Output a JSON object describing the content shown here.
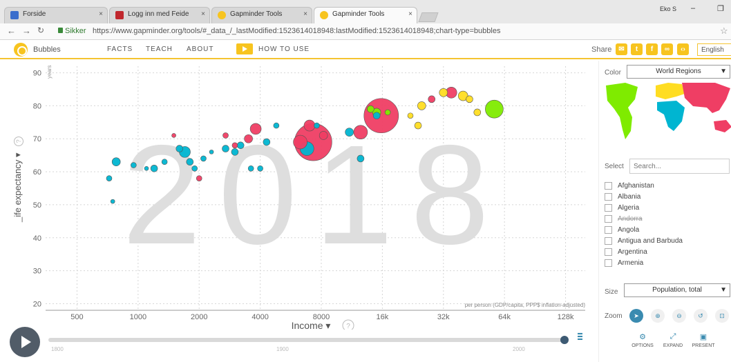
{
  "browser": {
    "tabs": [
      {
        "label": "Forside",
        "color": "#3b6ecc"
      },
      {
        "label": "Logg inn med Feide",
        "color": "#c0272d"
      },
      {
        "label": "Gapminder Tools",
        "color": "#f7c41f"
      },
      {
        "label": "Gapminder Tools",
        "color": "#f7c41f"
      }
    ],
    "close_glyph": "×",
    "user": "Eko S",
    "secure_label": "Sikker",
    "url": "https://www.gapminder.org/tools/#_data_/_lastModified:1523614018948:lastModified:1523614018948;chart-type=bubbles"
  },
  "app": {
    "title": "Bubbles",
    "menu": [
      "FACTS",
      "TEACH",
      "ABOUT"
    ],
    "how_to_use": "HOW TO USE",
    "share_label": "Share",
    "language": "English"
  },
  "chart": {
    "year_watermark": "2018",
    "y_unit": "years",
    "y_axis_label": "_ife expectancy ▾",
    "x_axis_label": "Income ▾",
    "x_note": "per person (GDP/capita, PPP$ inflation-adjusted)",
    "accent": "#f4c430"
  },
  "chart_data": {
    "type": "scatter",
    "title": "",
    "xlabel": "Income",
    "ylabel": "_ife expectancy",
    "x_scale": "log",
    "x_ticks": [
      500,
      1000,
      2000,
      4000,
      8000,
      16000,
      32000,
      64000,
      128000
    ],
    "x_tick_labels": [
      "500",
      "1000",
      "2000",
      "4000",
      "8000",
      "16k",
      "32k",
      "64k",
      "128k"
    ],
    "y_ticks": [
      20,
      30,
      40,
      50,
      60,
      70,
      80,
      90
    ],
    "xlim": [
      350,
      160000
    ],
    "ylim": [
      18,
      92
    ],
    "color_legend": {
      "africa": "#00b5d1",
      "asia": "#ef3e64",
      "europe": "#ffdd22",
      "americas": "#7feb00"
    },
    "points": [
      {
        "x": 720,
        "y": 58,
        "r": 4,
        "c": "africa"
      },
      {
        "x": 750,
        "y": 51,
        "r": 3,
        "c": "africa"
      },
      {
        "x": 780,
        "y": 63,
        "r": 6,
        "c": "africa"
      },
      {
        "x": 950,
        "y": 62,
        "r": 4,
        "c": "africa"
      },
      {
        "x": 1100,
        "y": 61,
        "r": 3,
        "c": "africa"
      },
      {
        "x": 1200,
        "y": 61,
        "r": 5,
        "c": "africa"
      },
      {
        "x": 1350,
        "y": 63,
        "r": 4,
        "c": "africa"
      },
      {
        "x": 1600,
        "y": 67,
        "r": 5,
        "c": "africa"
      },
      {
        "x": 1700,
        "y": 66,
        "r": 8,
        "c": "africa"
      },
      {
        "x": 1800,
        "y": 63,
        "r": 5,
        "c": "africa"
      },
      {
        "x": 1900,
        "y": 61,
        "r": 4,
        "c": "africa"
      },
      {
        "x": 2100,
        "y": 64,
        "r": 4,
        "c": "africa"
      },
      {
        "x": 2300,
        "y": 66,
        "r": 3,
        "c": "africa"
      },
      {
        "x": 2700,
        "y": 67,
        "r": 5,
        "c": "africa"
      },
      {
        "x": 3000,
        "y": 66,
        "r": 5,
        "c": "africa"
      },
      {
        "x": 3200,
        "y": 68,
        "r": 5,
        "c": "africa"
      },
      {
        "x": 3600,
        "y": 61,
        "r": 4,
        "c": "africa"
      },
      {
        "x": 4000,
        "y": 61,
        "r": 4,
        "c": "africa"
      },
      {
        "x": 4300,
        "y": 69,
        "r": 5,
        "c": "africa"
      },
      {
        "x": 4800,
        "y": 74,
        "r": 4,
        "c": "africa"
      },
      {
        "x": 6800,
        "y": 67,
        "r": 10,
        "c": "africa"
      },
      {
        "x": 7600,
        "y": 74,
        "r": 4,
        "c": "africa"
      },
      {
        "x": 11000,
        "y": 72,
        "r": 6,
        "c": "africa"
      },
      {
        "x": 12500,
        "y": 64,
        "r": 5,
        "c": "africa"
      },
      {
        "x": 15000,
        "y": 77,
        "r": 5,
        "c": "africa"
      },
      {
        "x": 1500,
        "y": 71,
        "r": 3,
        "c": "asia"
      },
      {
        "x": 2000,
        "y": 58,
        "r": 4,
        "c": "asia"
      },
      {
        "x": 2700,
        "y": 71,
        "r": 4,
        "c": "asia"
      },
      {
        "x": 3000,
        "y": 68,
        "r": 4,
        "c": "asia"
      },
      {
        "x": 3500,
        "y": 70,
        "r": 6,
        "c": "asia"
      },
      {
        "x": 3800,
        "y": 73,
        "r": 8,
        "c": "asia"
      },
      {
        "x": 6300,
        "y": 69,
        "r": 10,
        "c": "asia"
      },
      {
        "x": 7000,
        "y": 74,
        "r": 8,
        "c": "asia"
      },
      {
        "x": 7300,
        "y": 69,
        "r": 27,
        "c": "asia"
      },
      {
        "x": 8200,
        "y": 71,
        "r": 6,
        "c": "asia"
      },
      {
        "x": 12500,
        "y": 72,
        "r": 10,
        "c": "asia"
      },
      {
        "x": 15800,
        "y": 77,
        "r": 25,
        "c": "asia"
      },
      {
        "x": 35000,
        "y": 84,
        "r": 8,
        "c": "asia"
      },
      {
        "x": 28000,
        "y": 82,
        "r": 5,
        "c": "asia"
      },
      {
        "x": 14000,
        "y": 79,
        "r": 5,
        "c": "americas"
      },
      {
        "x": 15000,
        "y": 78,
        "r": 6,
        "c": "americas"
      },
      {
        "x": 17000,
        "y": 78,
        "r": 4,
        "c": "americas"
      },
      {
        "x": 57000,
        "y": 79,
        "r": 13,
        "c": "americas"
      },
      {
        "x": 22000,
        "y": 77,
        "r": 4,
        "c": "europe"
      },
      {
        "x": 25000,
        "y": 80,
        "r": 6,
        "c": "europe"
      },
      {
        "x": 32000,
        "y": 84,
        "r": 6,
        "c": "europe"
      },
      {
        "x": 40000,
        "y": 83,
        "r": 7,
        "c": "europe"
      },
      {
        "x": 43000,
        "y": 82,
        "r": 5,
        "c": "europe"
      },
      {
        "x": 47000,
        "y": 78,
        "r": 5,
        "c": "europe"
      },
      {
        "x": 24000,
        "y": 74,
        "r": 5,
        "c": "europe"
      }
    ]
  },
  "panel": {
    "color_label": "Color",
    "color_value": "World Regions",
    "select_label": "Select",
    "search_placeholder": "Search...",
    "countries": [
      "Afghanistan",
      "Albania",
      "Algeria",
      "Andorra",
      "Angola",
      "Antigua and Barbuda",
      "Argentina",
      "Armenia"
    ],
    "size_label": "Size",
    "size_value": "Population, total",
    "zoom_label": "Zoom",
    "footer": [
      "OPTIONS",
      "EXPAND",
      "PRESENT"
    ]
  },
  "timeline": {
    "ticks": [
      "1800",
      "1900",
      "2000"
    ],
    "value": 2018,
    "range": [
      1800,
      2018
    ]
  }
}
